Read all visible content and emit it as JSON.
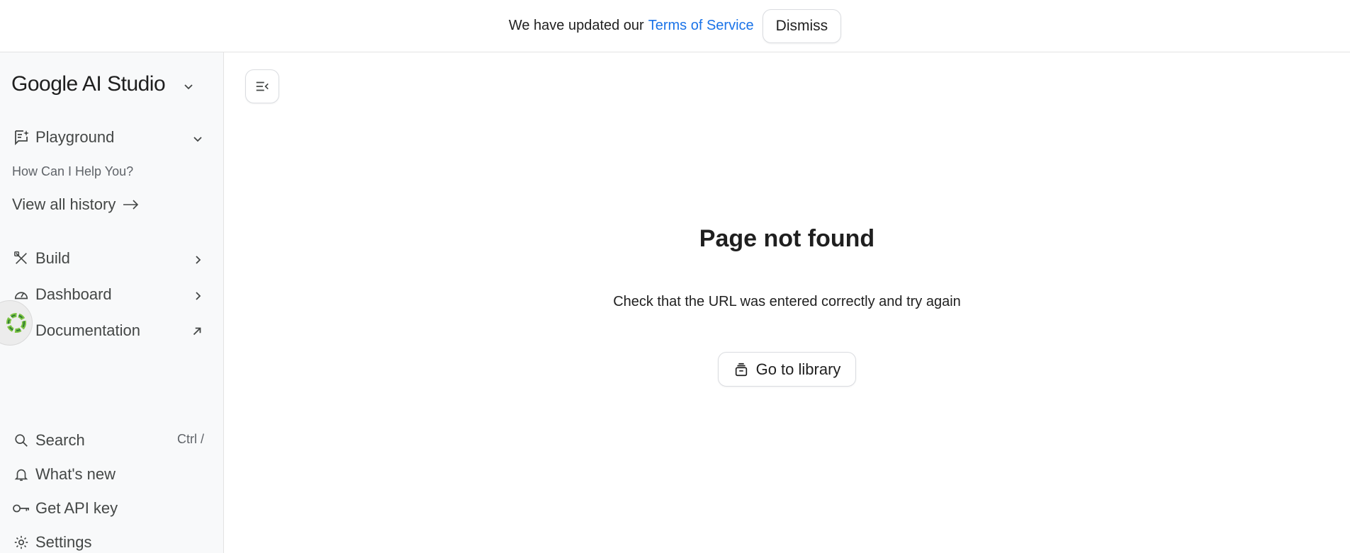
{
  "banner": {
    "message": "We have updated our",
    "link_text": "Terms of Service",
    "dismiss_label": "Dismiss"
  },
  "sidebar": {
    "brand": "Google AI Studio",
    "playground_label": "Playground",
    "history_item": "How Can I Help You?",
    "view_history_label": "View all history",
    "build_label": "Build",
    "dashboard_label": "Dashboard",
    "documentation_label": "Documentation",
    "search_label": "Search",
    "search_shortcut": "Ctrl /",
    "whats_new_label": "What's new",
    "api_key_label": "Get API key",
    "settings_label": "Settings"
  },
  "main": {
    "title": "Page not found",
    "subtitle": "Check that the URL was entered correctly and try again",
    "library_button": "Go to library"
  },
  "colors": {
    "link": "#1a73e8",
    "sidebar_bg": "#f8f9fa",
    "border": "#dadce0"
  }
}
